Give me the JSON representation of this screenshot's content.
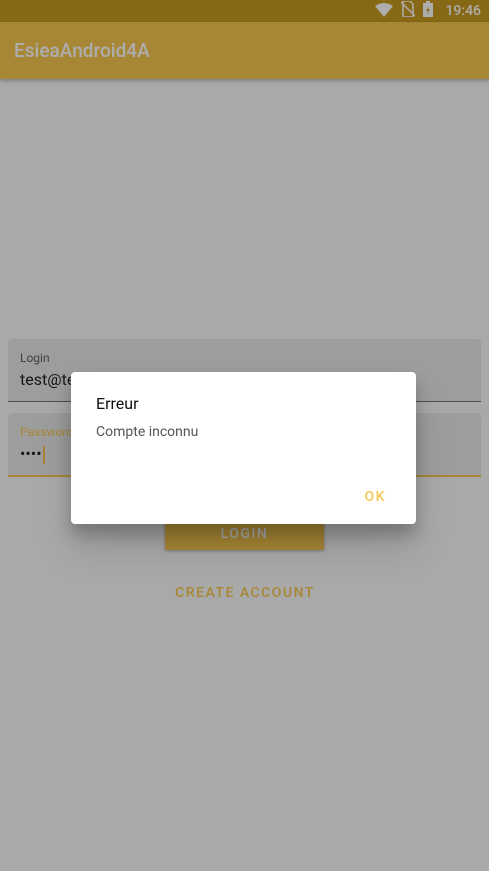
{
  "status_bar": {
    "time": "19:46",
    "icons": [
      "wifi-icon",
      "no-sim-icon",
      "battery-icon"
    ]
  },
  "app_bar": {
    "title": "EsieaAndroid4A"
  },
  "form": {
    "login_label": "Login",
    "login_value": "test@te",
    "password_label": "Password",
    "password_value": "••••",
    "login_button": "LOGIN",
    "create_button": "CREATE ACCOUNT"
  },
  "dialog": {
    "title": "Erreur",
    "message": "Compte inconnu",
    "ok_label": "OK"
  },
  "colors": {
    "accent": "#f7c84f",
    "status_bar": "#c89a1e",
    "scrim": "rgba(0,0,0,0.32)"
  }
}
